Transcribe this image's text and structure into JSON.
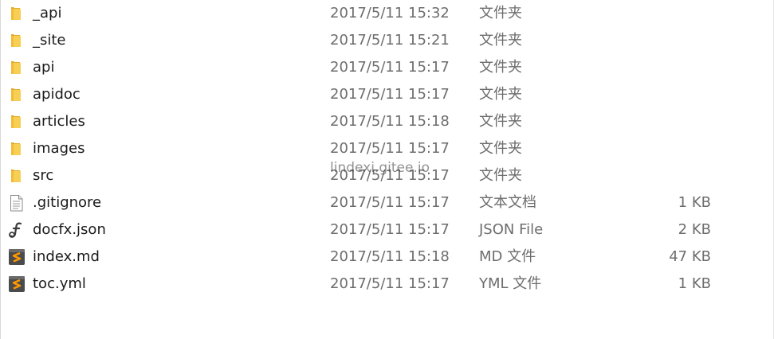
{
  "files": [
    {
      "name": "_api",
      "date": "2017/5/11 15:32",
      "type": "文件夹",
      "size": "",
      "icon": "folder-icon"
    },
    {
      "name": "_site",
      "date": "2017/5/11 15:21",
      "type": "文件夹",
      "size": "",
      "icon": "folder-icon"
    },
    {
      "name": "api",
      "date": "2017/5/11 15:17",
      "type": "文件夹",
      "size": "",
      "icon": "folder-icon"
    },
    {
      "name": "apidoc",
      "date": "2017/5/11 15:17",
      "type": "文件夹",
      "size": "",
      "icon": "folder-icon"
    },
    {
      "name": "articles",
      "date": "2017/5/11 15:18",
      "type": "文件夹",
      "size": "",
      "icon": "folder-icon"
    },
    {
      "name": "images",
      "date": "2017/5/11 15:17",
      "type": "文件夹",
      "size": "",
      "icon": "folder-icon"
    },
    {
      "name": "src",
      "date": "2017/5/11 15:17",
      "type": "文件夹",
      "size": "",
      "icon": "folder-icon"
    },
    {
      "name": ".gitignore",
      "date": "2017/5/11 15:17",
      "type": "文本文档",
      "size": "1 KB",
      "icon": "text-file-icon"
    },
    {
      "name": "docfx.json",
      "date": "2017/5/11 15:17",
      "type": "JSON File",
      "size": "2 KB",
      "icon": "json-file-icon"
    },
    {
      "name": "index.md",
      "date": "2017/5/11 15:18",
      "type": "MD 文件",
      "size": "47 KB",
      "icon": "sublime-file-icon"
    },
    {
      "name": "toc.yml",
      "date": "2017/5/11 15:17",
      "type": "YML 文件",
      "size": "1 KB",
      "icon": "sublime-file-icon"
    }
  ],
  "watermark": "lindexi.gitee.io",
  "colors": {
    "folder": "#f6c94a",
    "sublime_bg": "#4b4b4b",
    "sublime_accent": "#ff9800",
    "secondary_text": "#6d6d6d"
  }
}
